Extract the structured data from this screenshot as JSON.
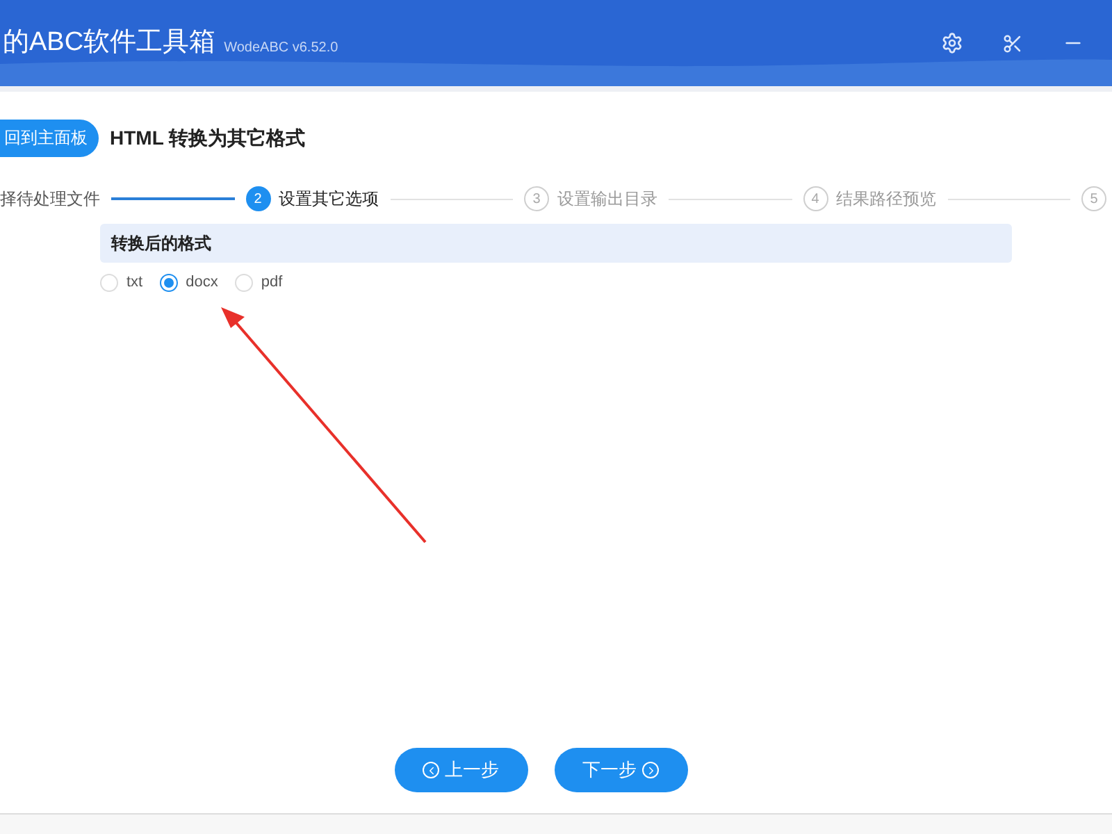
{
  "header": {
    "title": "的ABC软件工具箱",
    "version": "WodeABC v6.52.0"
  },
  "toolbar": {
    "back_button": "回到主面板",
    "page_title": "HTML 转换为其它格式"
  },
  "steps": [
    {
      "label": "择待处理文件",
      "selected": false,
      "completed": true
    },
    {
      "number": "2",
      "label": "设置其它选项",
      "selected": true,
      "completed": false
    },
    {
      "number": "3",
      "label": "设置输出目录",
      "selected": false,
      "completed": false
    },
    {
      "number": "4",
      "label": "结果路径预览",
      "selected": false,
      "completed": false
    },
    {
      "number": "5",
      "selected": false,
      "completed": false
    }
  ],
  "format_section": {
    "heading": "转换后的格式",
    "options": [
      {
        "label": "txt",
        "selected": false
      },
      {
        "label": "docx",
        "selected": true
      },
      {
        "label": "pdf",
        "selected": false
      }
    ]
  },
  "buttons": {
    "previous": "上一步",
    "next": "下一步"
  }
}
